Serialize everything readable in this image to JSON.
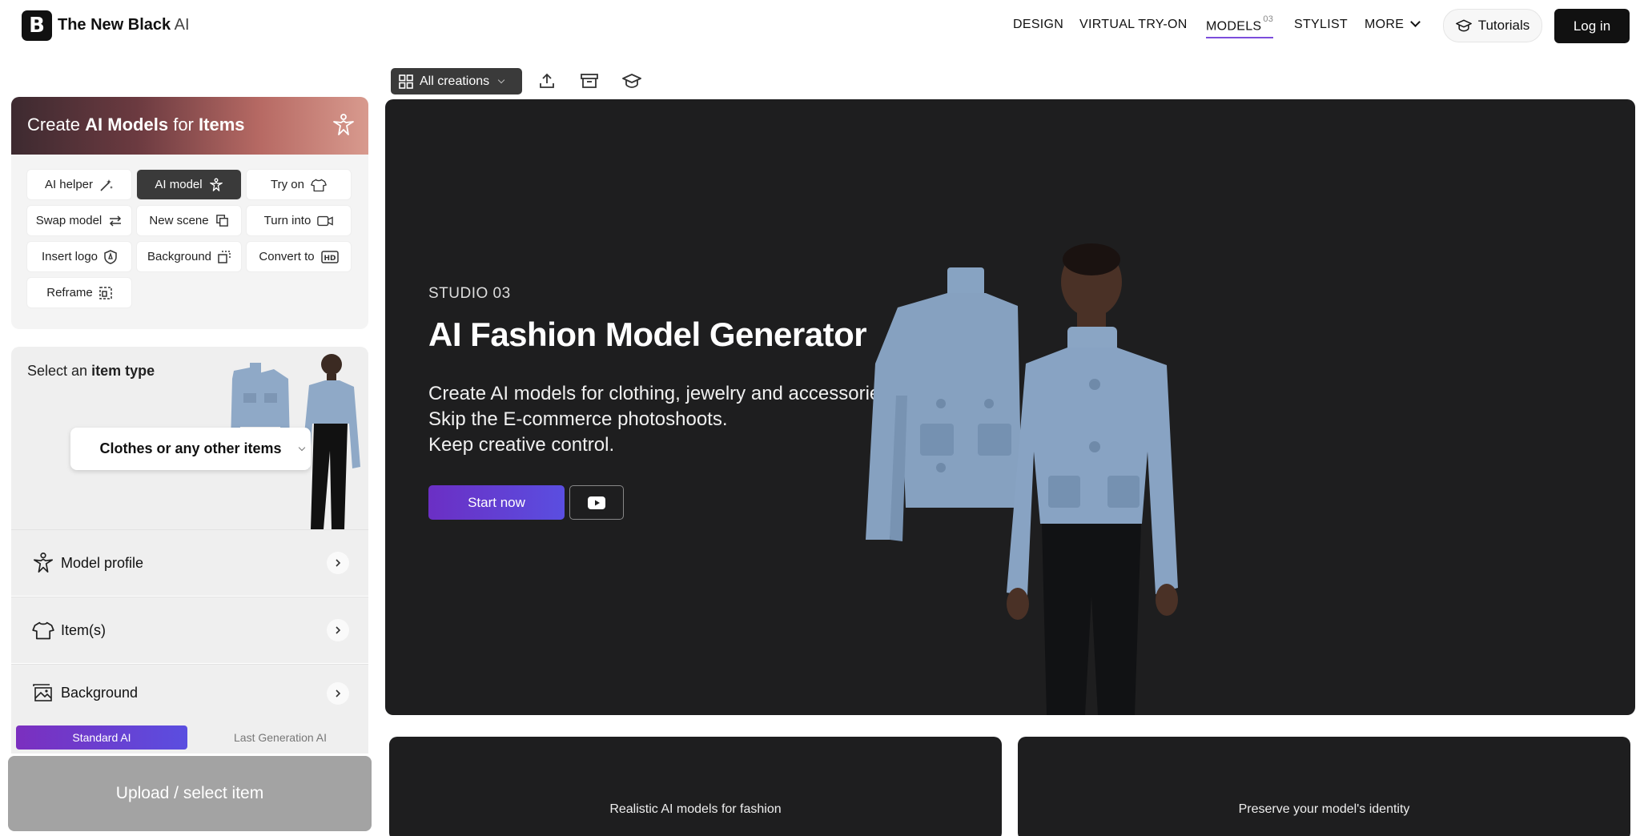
{
  "header": {
    "logo_letter": "B",
    "brand_name": "The New Black",
    "brand_suffix": "AI",
    "nav": {
      "design": "DESIGN",
      "virtual_try_on": "VIRTUAL TRY-ON",
      "models": "MODELS",
      "models_badge": "03",
      "stylist": "STYLIST",
      "more": "MORE"
    },
    "tutorials": "Tutorials",
    "login": "Log in"
  },
  "toolbar": {
    "all_creations": "All creations",
    "icons": [
      "upload-icon",
      "archive-icon",
      "graduation-cap-icon"
    ]
  },
  "create_card": {
    "title_prefix": "Create",
    "title_bold1": "AI Models",
    "title_mid": "for",
    "title_bold2": "Items",
    "chips": {
      "ai_helper": "AI helper",
      "ai_model": "AI model",
      "try_on": "Try on",
      "swap_model": "Swap model",
      "new_scene": "New scene",
      "turn_into": "Turn into",
      "insert_logo": "Insert logo",
      "background": "Background",
      "convert_to": "Convert to",
      "reframe": "Reframe"
    }
  },
  "item_type": {
    "title_prefix": "Select an",
    "title_bold": "item type",
    "selected": "Clothes or any other items"
  },
  "accordion": {
    "model_profile": "Model profile",
    "items": "Item(s)",
    "background": "Background"
  },
  "ai_mode": {
    "standard": "Standard AI",
    "last_gen": "Last Generation AI"
  },
  "upload": "Upload / select item",
  "hero": {
    "kicker": "STUDIO 03",
    "title": "AI Fashion Model Generator",
    "desc_line1": "Create AI models for clothing, jewelry and accessories.",
    "desc_line2": "Skip the E-commerce photoshoots.",
    "desc_line3": "Keep creative control.",
    "start": "Start now"
  },
  "cards": {
    "left": "Realistic AI models for fashion",
    "right": "Preserve your model's identity"
  },
  "colors": {
    "accent_purple": "#6b2fc4",
    "accent_blue": "#5a4ee0",
    "dark_bg": "#1e1e1f",
    "jacket_blue": "#7f9cbf"
  }
}
